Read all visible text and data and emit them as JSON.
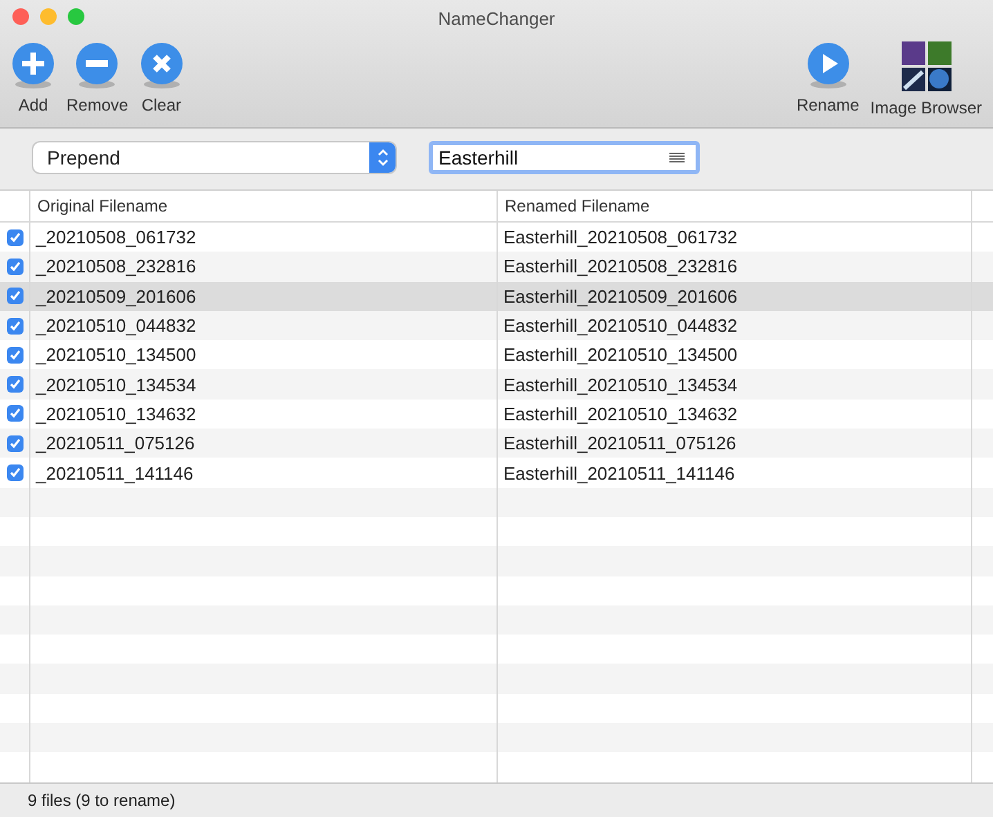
{
  "window": {
    "title": "NameChanger"
  },
  "toolbar_left": [
    {
      "kind": "add",
      "label": "Add"
    },
    {
      "kind": "remove",
      "label": "Remove"
    },
    {
      "kind": "clear",
      "label": "Clear"
    }
  ],
  "toolbar_right": [
    {
      "kind": "rename",
      "label": "Rename"
    },
    {
      "kind": "browser",
      "label": "Image Browser"
    }
  ],
  "mode_select": {
    "value": "Prepend"
  },
  "text_field": {
    "value": "Easterhill"
  },
  "table": {
    "columns": [
      "Original Filename",
      "Renamed Filename"
    ],
    "rows": [
      {
        "checked": true,
        "selected": false,
        "original": "_20210508_061732",
        "renamed": "Easterhill_20210508_061732"
      },
      {
        "checked": true,
        "selected": false,
        "original": "_20210508_232816",
        "renamed": "Easterhill_20210508_232816"
      },
      {
        "checked": true,
        "selected": true,
        "original": "_20210509_201606",
        "renamed": "Easterhill_20210509_201606"
      },
      {
        "checked": true,
        "selected": false,
        "original": "_20210510_044832",
        "renamed": "Easterhill_20210510_044832"
      },
      {
        "checked": true,
        "selected": false,
        "original": "_20210510_134500",
        "renamed": "Easterhill_20210510_134500"
      },
      {
        "checked": true,
        "selected": false,
        "original": "_20210510_134534",
        "renamed": "Easterhill_20210510_134534"
      },
      {
        "checked": true,
        "selected": false,
        "original": "_20210510_134632",
        "renamed": "Easterhill_20210510_134632"
      },
      {
        "checked": true,
        "selected": false,
        "original": "_20210511_075126",
        "renamed": "Easterhill_20210511_075126"
      },
      {
        "checked": true,
        "selected": false,
        "original": "_20210511_141146",
        "renamed": "Easterhill_20210511_141146"
      }
    ]
  },
  "status_bar": "9 files (9 to rename)"
}
